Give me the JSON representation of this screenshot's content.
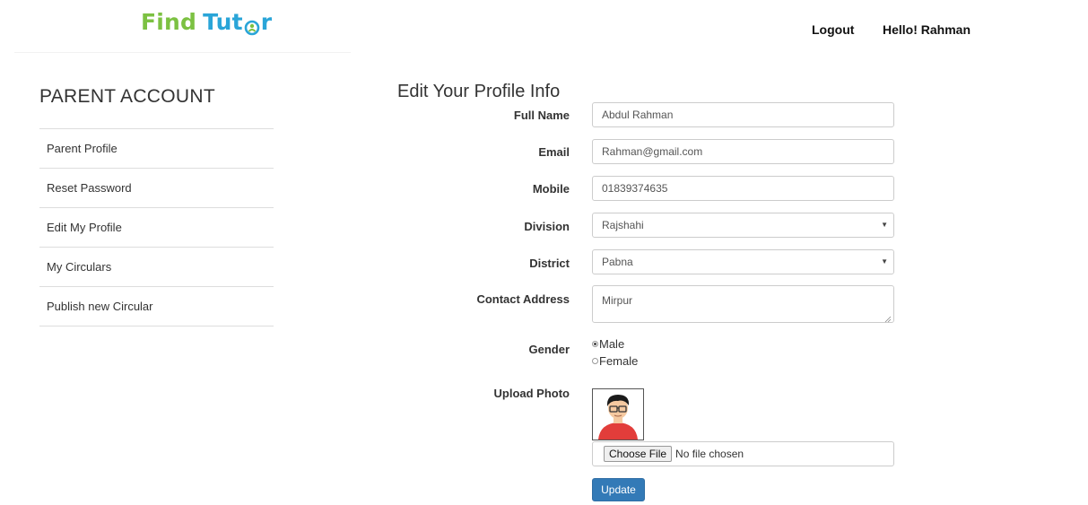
{
  "brand": {
    "find": "Find",
    "tut": "Tut",
    "r": "r",
    "find_color": "#7cc142",
    "tutor_color": "#2aa5d8",
    "o_icon": "person-in-circle-icon"
  },
  "header": {
    "logout": "Logout",
    "greeting": "Hello! Rahman"
  },
  "sidebar": {
    "title": "PARENT ACCOUNT",
    "items": [
      {
        "label": "Parent Profile"
      },
      {
        "label": "Reset Password"
      },
      {
        "label": "Edit My Profile"
      },
      {
        "label": "My Circulars"
      },
      {
        "label": "Publish new Circular"
      }
    ]
  },
  "form": {
    "title": "Edit Your Profile Info",
    "full_name": {
      "label": "Full Name",
      "value": "Abdul Rahman"
    },
    "email": {
      "label": "Email",
      "value": "Rahman@gmail.com"
    },
    "mobile": {
      "label": "Mobile",
      "value": "01839374635"
    },
    "division": {
      "label": "Division",
      "value": "Rajshahi"
    },
    "district": {
      "label": "District",
      "value": "Pabna"
    },
    "address": {
      "label": "Contact Address",
      "value": "Mirpur"
    },
    "gender": {
      "label": "Gender",
      "options": [
        {
          "label": "Male",
          "checked": true
        },
        {
          "label": "Female",
          "checked": false
        }
      ]
    },
    "photo": {
      "label": "Upload Photo",
      "choose_label": "Choose File",
      "status": "No file chosen"
    },
    "submit": "Update",
    "submit_color": "#337ab7"
  }
}
